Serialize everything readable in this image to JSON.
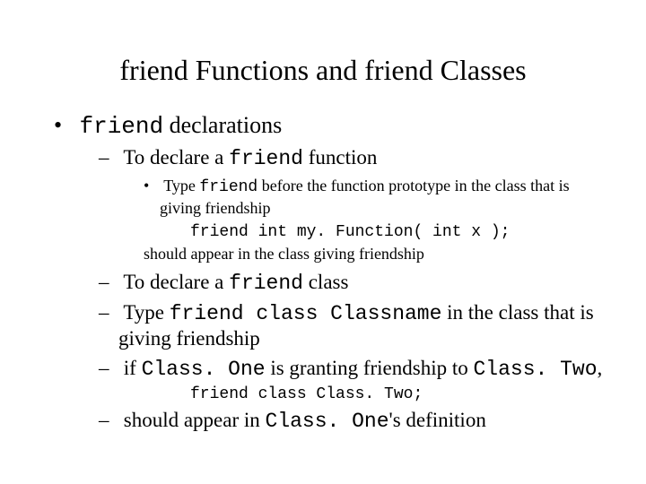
{
  "title": "friend Functions and friend Classes",
  "b1": {
    "item": {
      "kw": "friend",
      "rest": " declarations"
    }
  },
  "b2": {
    "i0": {
      "pre": "To declare a ",
      "kw": "friend",
      "post": " function"
    },
    "i1": {
      "pre": "To declare a ",
      "kw": "friend",
      "post": " class"
    },
    "i2": {
      "pre": "Type ",
      "kw": "friend class Classname",
      "post": " in the class that is giving friendship"
    },
    "i3": {
      "pre": "if ",
      "kw1": "Class. One",
      "mid": " is granting friendship to ",
      "kw2": "Class. Two",
      "post": ","
    },
    "i4": {
      "pre": " should appear in ",
      "kw": "Class. One",
      "post": "'s definition"
    }
  },
  "b3": {
    "i0": {
      "pre": "Type ",
      "kw": "friend",
      "post": " before the function prototype in the class that is giving friendship"
    }
  },
  "code": {
    "c1": "friend int my. Function( int x );",
    "c2": "friend class Class. Two;"
  },
  "after": {
    "a1": "should appear in the class giving friendship"
  }
}
